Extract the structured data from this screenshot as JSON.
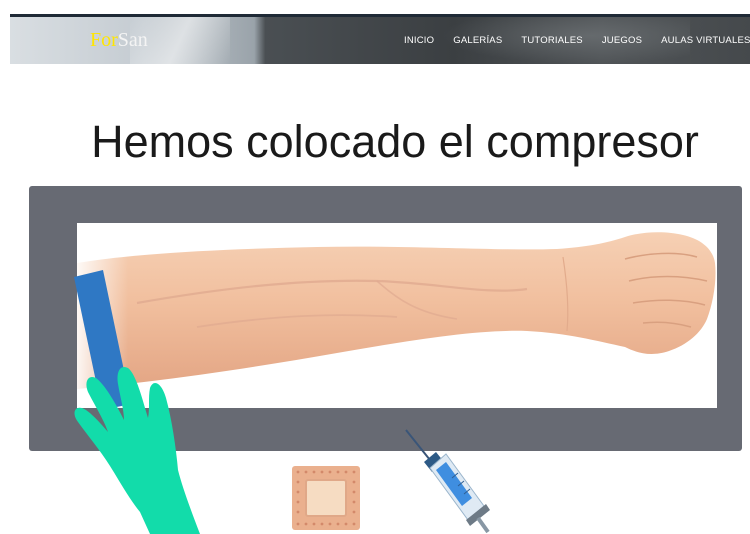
{
  "header": {
    "logo_part1": "For",
    "logo_part2": "San",
    "nav": [
      {
        "label": "INICIO"
      },
      {
        "label": "GALERÍAS"
      },
      {
        "label": "TUTORIALES"
      },
      {
        "label": "JUEGOS"
      },
      {
        "label": "AULAS VIRTUALES"
      }
    ]
  },
  "main": {
    "title": "Hemos colocado el compresor"
  },
  "colors": {
    "logo_accent": "#ffe600",
    "frame": "#676a73",
    "tourniquet": "#2f78c4",
    "glove": "#12dcaa",
    "skin": "#f2c2a2"
  },
  "icons": [
    "arm-photo",
    "tourniquet-icon",
    "gloved-hand-icon",
    "adhesive-bandage-icon",
    "syringe-icon"
  ]
}
